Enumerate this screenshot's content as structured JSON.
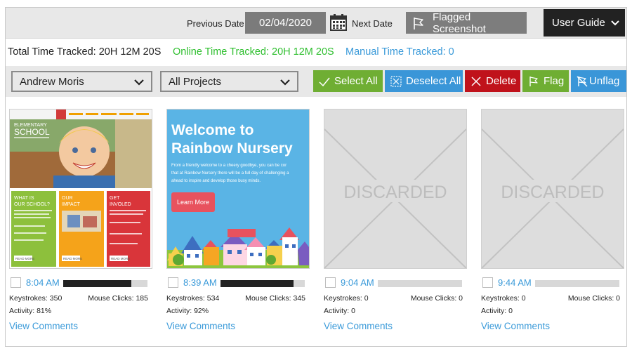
{
  "header": {
    "previous_date_label": "Previous Date",
    "date_value": "02/04/2020",
    "next_date_label": "Next Date",
    "flagged_label": "Flagged Screenshot",
    "user_guide_label": "User Guide"
  },
  "totals": {
    "total": "Total Time Tracked: 20H 12M 20S",
    "online": "Online Time Tracked: 20H 12M 20S",
    "manual": "Manual Time Tracked: 0"
  },
  "filters": {
    "user_selected": "Andrew Moris",
    "project_selected": "All Projects"
  },
  "actions": {
    "select_all": "Select All",
    "deselect_all": "Deselect All",
    "delete": "Delete",
    "flag": "Flag",
    "unflag": "Unflag"
  },
  "colors": {
    "green": "#6fae33",
    "blue": "#3a96d8",
    "red": "#c0121b",
    "online_text": "#2fbf2f"
  },
  "screenshots": [
    {
      "thumb": {
        "kind": "school",
        "school_title_1": "ELEMENTARY",
        "school_title_2": "SCHOOL",
        "box1_line1": "WHAT IS",
        "box1_line2": "OUR SCHOOL?",
        "box2_line1": "OUR",
        "box2_line2": "IMPACT",
        "box3_line1": "GET",
        "box3_line2": "INVOLED",
        "read_more": "READ MORE"
      },
      "time": "8:04 AM",
      "activity_fill": 0.81,
      "keystrokes": "Keystrokes: 350",
      "mouse_clicks": "Mouse Clicks: 185",
      "activity": "Activity: 81%",
      "view_comments": "View Comments"
    },
    {
      "thumb": {
        "kind": "nursery",
        "headline_1": "Welcome to",
        "headline_2": "Rainbow Nursery",
        "body_1": "From a friendly welcome to a cheery goodbye, you can be cor",
        "body_2": "that at Rainbow Nursery there will be a full day of challenging a",
        "body_3": "ahead to inspire and develop those busy minds.",
        "learn_more": "Learn More"
      },
      "time": "8:39 AM",
      "activity_fill": 0.87,
      "keystrokes": "Keystrokes: 534",
      "mouse_clicks": "Mouse Clicks: 345",
      "activity": "Activity: 92%",
      "view_comments": "View Comments"
    },
    {
      "thumb": {
        "kind": "discarded",
        "label": "DISCARDED"
      },
      "time": "9:04 AM",
      "activity_fill": 0,
      "keystrokes": "Keystrokes: 0",
      "mouse_clicks": "Mouse Clicks: 0",
      "activity": "Activity: 0",
      "view_comments": "View Comments"
    },
    {
      "thumb": {
        "kind": "discarded",
        "label": "DISCARDED"
      },
      "time": "9:44 AM",
      "activity_fill": 0,
      "keystrokes": "Keystrokes: 0",
      "mouse_clicks": "Mouse Clicks: 0",
      "activity": "Activity: 0",
      "view_comments": "View Comments"
    }
  ]
}
